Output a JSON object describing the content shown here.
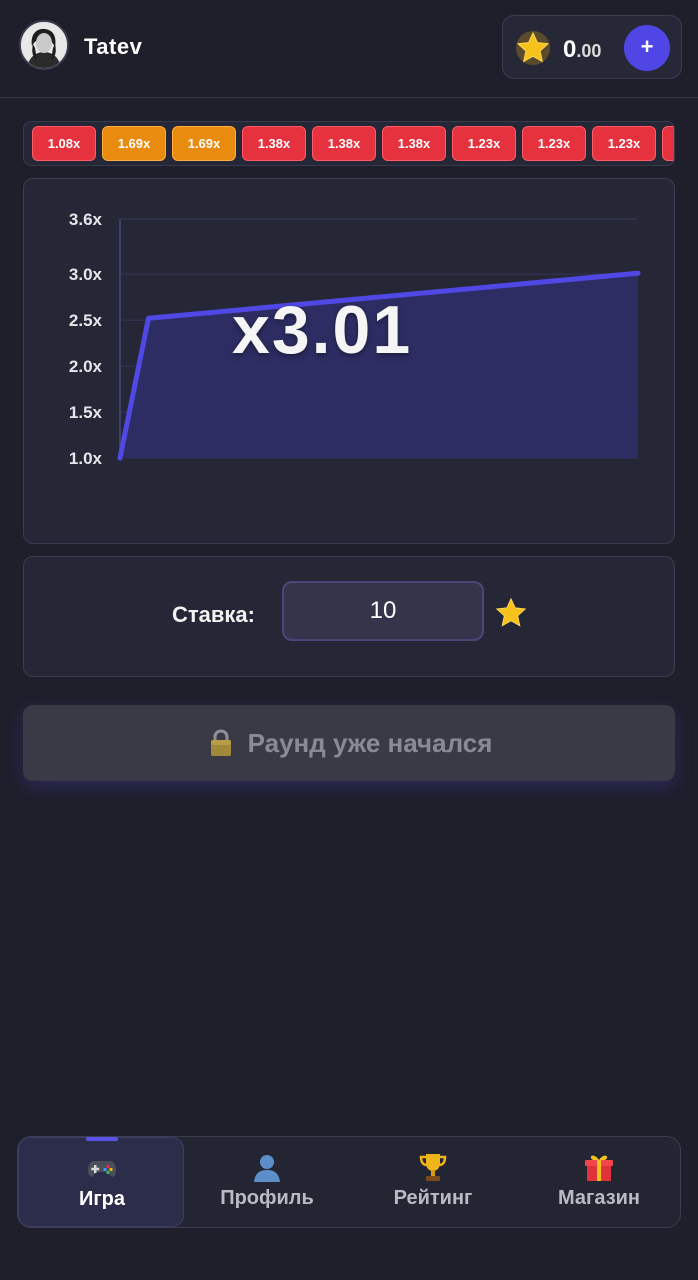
{
  "header": {
    "username": "Tatev",
    "balance_int": "0",
    "balance_dec": ".00",
    "add_label": "+"
  },
  "history": [
    {
      "label": "1.08x",
      "color": "red"
    },
    {
      "label": "1.69x",
      "color": "orange"
    },
    {
      "label": "1.69x",
      "color": "orange"
    },
    {
      "label": "1.38x",
      "color": "red"
    },
    {
      "label": "1.38x",
      "color": "red"
    },
    {
      "label": "1.38x",
      "color": "red"
    },
    {
      "label": "1.23x",
      "color": "red"
    },
    {
      "label": "1.23x",
      "color": "red"
    },
    {
      "label": "1.23x",
      "color": "red"
    },
    {
      "label": "",
      "color": "red"
    }
  ],
  "chart_data": {
    "type": "area",
    "y_tick_labels": [
      "1.0x",
      "1.5x",
      "2.0x",
      "2.5x",
      "3.0x",
      "3.6x"
    ],
    "y_ticks": [
      1.0,
      1.5,
      2.0,
      2.5,
      3.0,
      3.6
    ],
    "ylim": [
      1.0,
      3.6
    ],
    "x": [
      0,
      0.055,
      1
    ],
    "y": [
      1.0,
      2.52,
      3.01
    ],
    "line_color": "#5048e5",
    "fill_color": "#2f2f6b"
  },
  "game": {
    "multiplier": "x3.01"
  },
  "bet": {
    "label": "Ставка:",
    "value": "10"
  },
  "round_button": {
    "label": "Раунд уже начался"
  },
  "nav": [
    {
      "label": "Игра",
      "icon": "gamepad-icon",
      "active": true
    },
    {
      "label": "Профиль",
      "icon": "user-icon",
      "active": false
    },
    {
      "label": "Рейтинг",
      "icon": "trophy-icon",
      "active": false
    },
    {
      "label": "Магазин",
      "icon": "gift-icon",
      "active": false
    }
  ]
}
